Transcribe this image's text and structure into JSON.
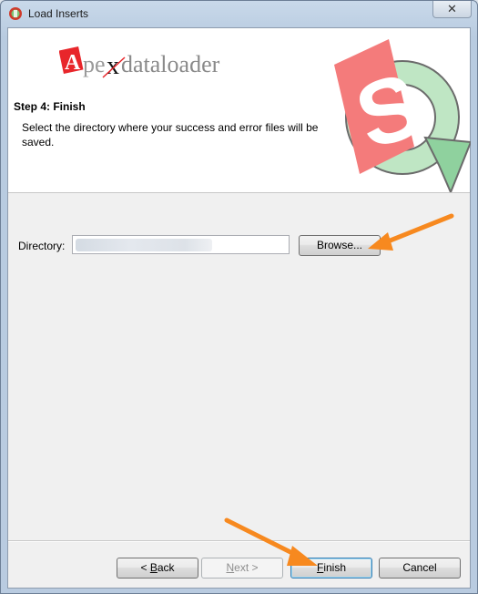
{
  "window": {
    "title": "Load Inserts",
    "close_glyph": "✕"
  },
  "header": {
    "logo_text_prefix": "A",
    "logo_text_main": "pe",
    "logo_text_x": "x",
    "logo_text_rest": "dataloader",
    "step_title": "Step 4: Finish",
    "step_description": "Select the directory where your success and error files will be saved."
  },
  "form": {
    "directory_label": "Directory:",
    "directory_value": "",
    "browse_label": "Browse..."
  },
  "footer": {
    "back_prefix": "< ",
    "back_accel": "B",
    "back_rest": "ack",
    "next_accel": "N",
    "next_rest": "ext >",
    "finish_accel": "F",
    "finish_rest": "inish",
    "cancel_label": "Cancel"
  },
  "colors": {
    "accent_orange": "#f7891f",
    "logo_red": "#e8262b",
    "sf_green": "#8fd19e",
    "sf_pink": "#f47b7b"
  }
}
